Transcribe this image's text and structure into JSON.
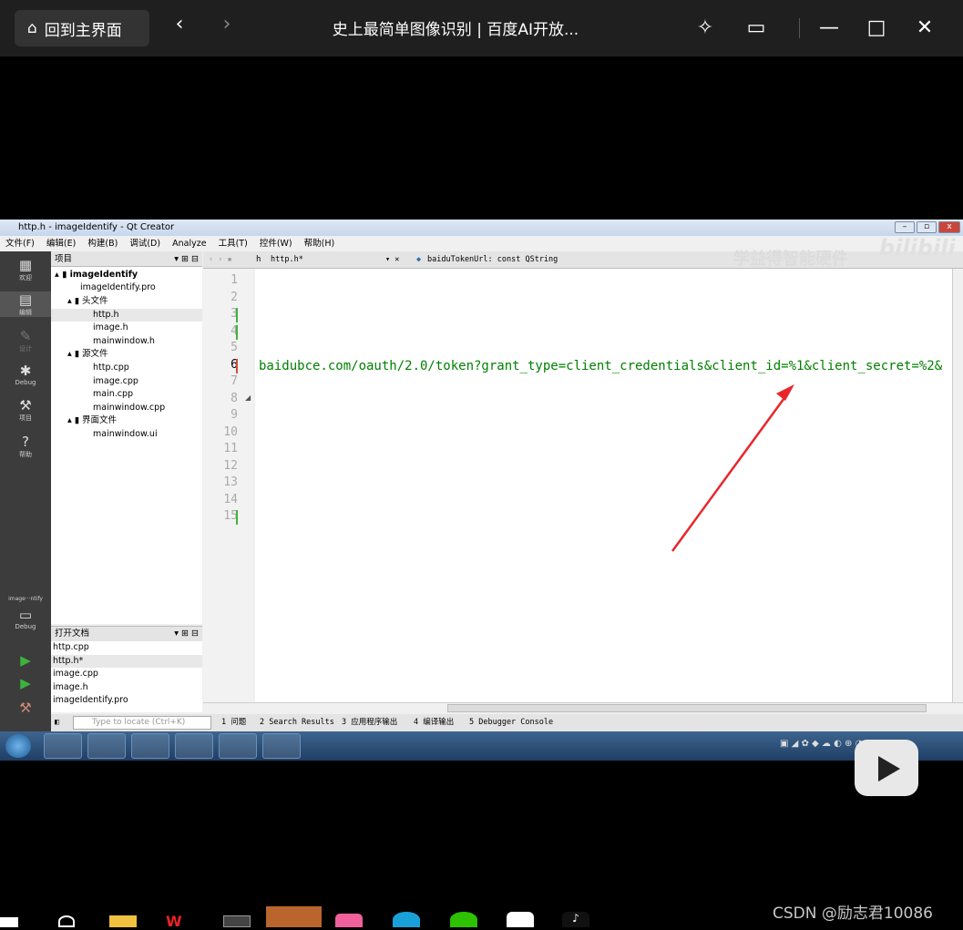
{
  "player": {
    "home_label": "回到主界面",
    "title": "史上最简单图像识别 | 百度AI开放...",
    "back_glyph": "‹",
    "forward_glyph": "›"
  },
  "qt": {
    "window_title": "http.h - imageIdentify - Qt Creator",
    "menu": [
      "文件(F)",
      "编辑(E)",
      "构建(B)",
      "调试(D)",
      "Analyze",
      "工具(T)",
      "控件(W)",
      "帮助(H)"
    ],
    "modes": [
      "欢迎",
      "编辑",
      "设计",
      "Debug",
      "项目",
      "帮助"
    ],
    "kit": {
      "name": "image···ntify",
      "mode": "Debug"
    },
    "project_header": "项目",
    "tree": {
      "root": "imageIdentify",
      "pro": "imageIdentify.pro",
      "headers": "头文件",
      "h1": "http.h",
      "h2": "image.h",
      "h3": "mainwindow.h",
      "sources": "源文件",
      "s1": "http.cpp",
      "s2": "image.cpp",
      "s3": "main.cpp",
      "s4": "mainwindow.cpp",
      "forms": "界面文件",
      "f1": "mainwindow.ui"
    },
    "open_docs_header": "打开文档",
    "open_docs": [
      "http.cpp",
      "http.h*",
      "image.cpp",
      "image.h",
      "imageIdentify.pro"
    ],
    "editor": {
      "file": "http.h*",
      "symbol": "baiduTokenUrl: const QString",
      "line_numbers": [
        "1",
        "2",
        "3",
        "4",
        "5",
        "6",
        "7",
        "8",
        "9",
        "10",
        "11",
        "12",
        "13",
        "14",
        "15"
      ],
      "code": "baidubce.com/oauth/2.0/token?grant_type=client_credentials&client_id=%1&client_secret=%2&"
    },
    "locate_placeholder": "Type to locate (Ctrl+K)",
    "output_tabs": [
      "1 问题",
      "2 Search Results",
      "3 应用程序输出",
      "4 编译输出",
      "5 Debugger Console"
    ]
  },
  "watermark": {
    "channel": "学益得智能硬件",
    "brand": "bilibili"
  },
  "credit": "CSDN @励志君10086",
  "colors": {
    "arrow": "#e8262a",
    "code": "#008000"
  }
}
